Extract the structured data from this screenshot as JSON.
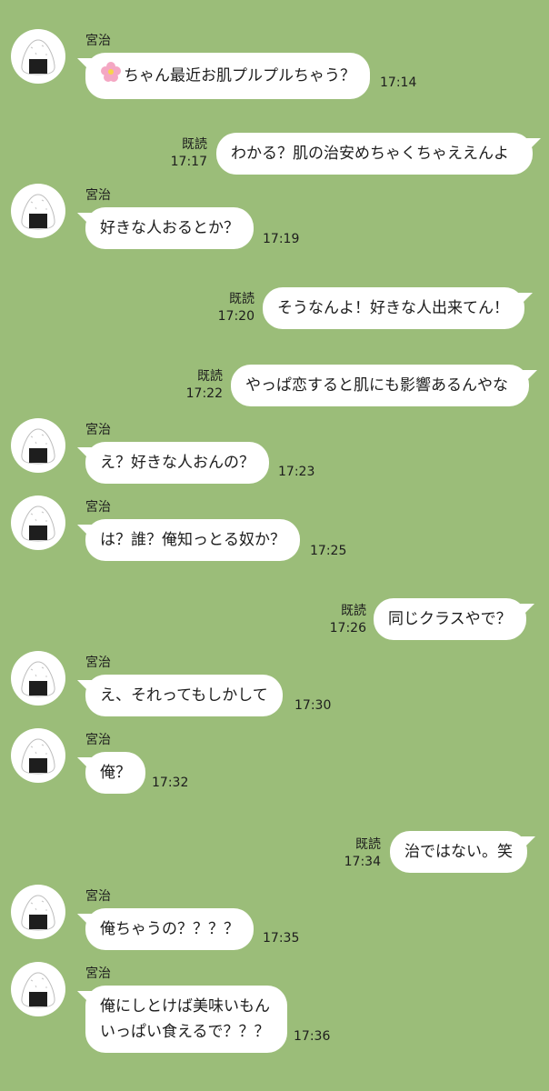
{
  "contact": {
    "name": "宮治",
    "avatar_icon": "onigiri-icon"
  },
  "read_label": "既読",
  "messages": [
    {
      "dir": "in",
      "text": "ちゃん最近お肌プルプルちゃう？",
      "prefix_icon": "flower-icon",
      "time": "17:14"
    },
    {
      "dir": "out",
      "text": "わかる？肌の治安めちゃくちゃええんよ",
      "time": "17:17"
    },
    {
      "dir": "in",
      "text": "好きな人おるとか？",
      "time": "17:19"
    },
    {
      "dir": "out",
      "text": "そうなんよ！好きな人出来てん！",
      "time": "17:20"
    },
    {
      "dir": "out",
      "text": "やっぱ恋すると肌にも影響あるんやな",
      "time": "17:22"
    },
    {
      "dir": "in",
      "text": "え？好きな人おんの？",
      "time": "17:23"
    },
    {
      "dir": "in",
      "text": "は？誰？俺知っとる奴か？",
      "time": "17:25"
    },
    {
      "dir": "out",
      "text": "同じクラスやで？",
      "time": "17:26"
    },
    {
      "dir": "in",
      "text": "え、それってもしかして",
      "time": "17:30"
    },
    {
      "dir": "in",
      "text": "俺？",
      "time": "17:32"
    },
    {
      "dir": "out",
      "text": "治ではない。笑",
      "time": "17:34"
    },
    {
      "dir": "in",
      "text": "俺ちゃうの？？？？",
      "time": "17:35"
    },
    {
      "dir": "in",
      "lines": [
        "俺にしとけば美味いもん",
        "いっぱい食えるで？？？"
      ],
      "time": "17:36"
    }
  ]
}
